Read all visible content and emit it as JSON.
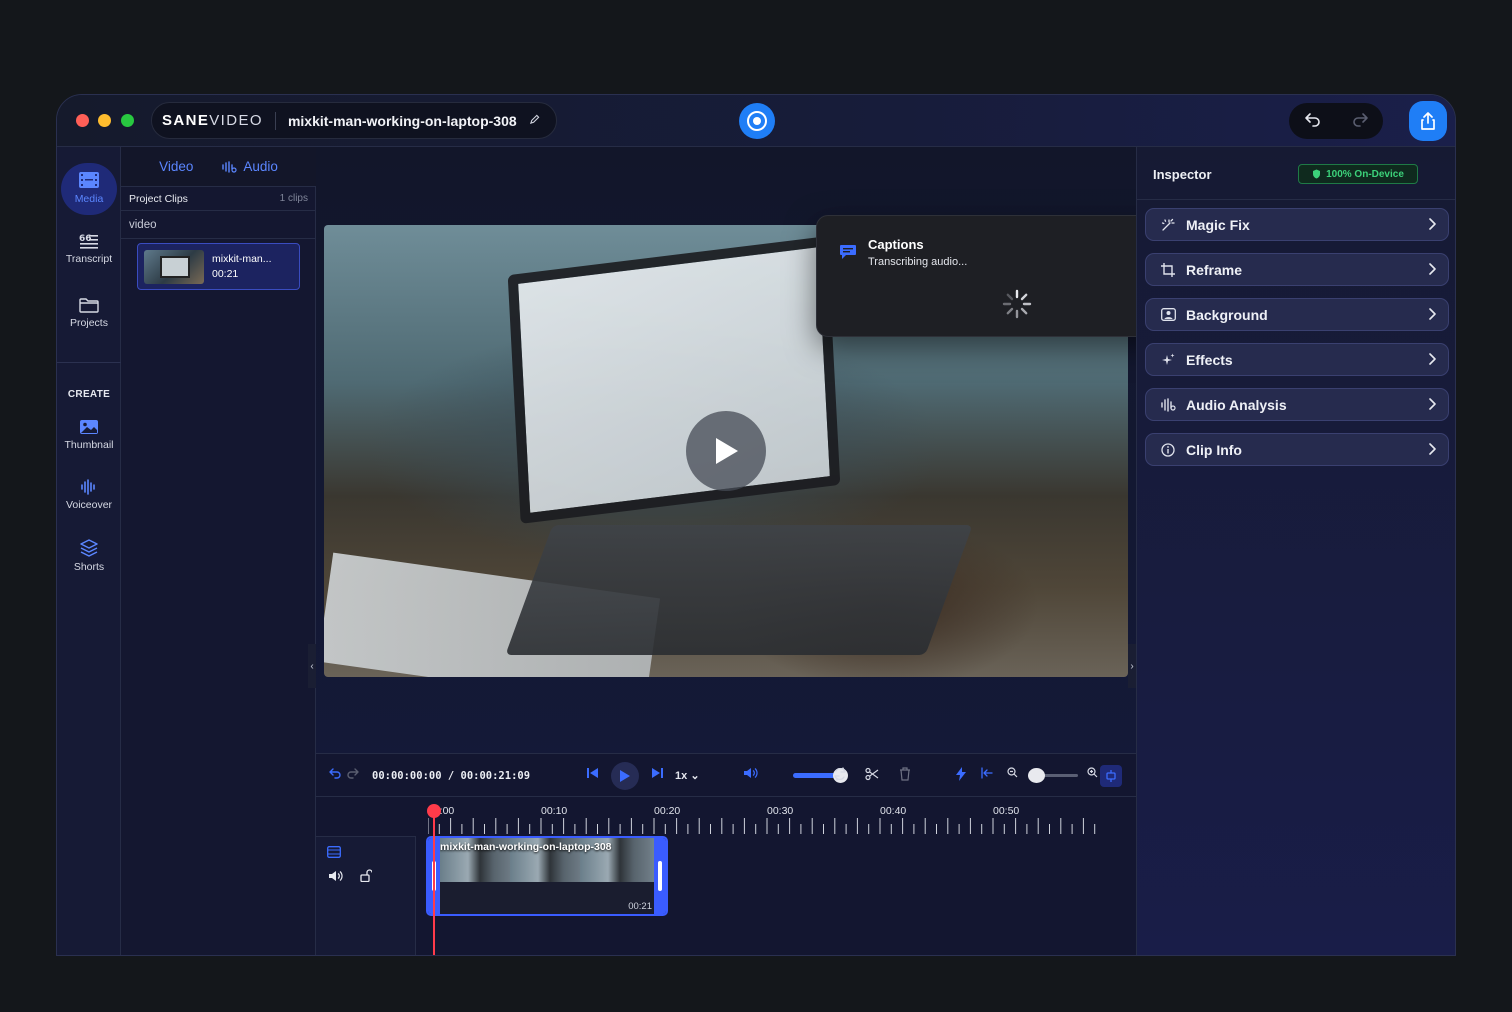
{
  "titlebar": {
    "brand_bold": "SANE",
    "brand_light": "VIDEO",
    "project_name": "mixkit-man-working-on-laptop-308"
  },
  "leftnav": {
    "items": [
      {
        "label": "Media",
        "icon": "film-icon"
      },
      {
        "label": "Transcript",
        "icon": "transcript-icon"
      },
      {
        "label": "Projects",
        "icon": "folder-icon"
      }
    ],
    "create_heading": "CREATE",
    "create_items": [
      {
        "label": "Thumbnail",
        "icon": "image-icon"
      },
      {
        "label": "Voiceover",
        "icon": "waveform-icon"
      },
      {
        "label": "Shorts",
        "icon": "layers-icon"
      }
    ]
  },
  "media_panel": {
    "tabs": [
      "Video",
      "Audio"
    ],
    "section_label": "Project Clips",
    "clip_count": "1 clips",
    "group_label": "video",
    "clip": {
      "name": "mixkit-man...",
      "duration": "00:21"
    }
  },
  "toast": {
    "title": "Captions",
    "subtitle": "Transcribing audio..."
  },
  "inspector": {
    "title": "Inspector",
    "badge": "100% On-Device",
    "rows": [
      {
        "label": "Magic Fix",
        "icon": "magic-wand-icon"
      },
      {
        "label": "Reframe",
        "icon": "crop-icon"
      },
      {
        "label": "Background",
        "icon": "portrait-icon"
      },
      {
        "label": "Effects",
        "icon": "sparkle-icon"
      },
      {
        "label": "Audio Analysis",
        "icon": "waveform-icon"
      },
      {
        "label": "Clip Info",
        "icon": "info-icon"
      }
    ]
  },
  "timeline": {
    "timecode": "00:00:00:00 / 00:00:21:09",
    "speed": "1x",
    "volume_level": 1.0,
    "zoom_level": 0.05,
    "ruler_labels": [
      "00:00",
      "00:10",
      "00:20",
      "00:30",
      "00:40",
      "00:50"
    ],
    "clip": {
      "title": "mixkit-man-working-on-laptop-308",
      "duration": "00:21"
    }
  },
  "colors": {
    "accent": "#1f7ef6",
    "selection": "#3a5cff",
    "playhead": "#ff3b4a",
    "badge_green": "#3cd27a"
  }
}
